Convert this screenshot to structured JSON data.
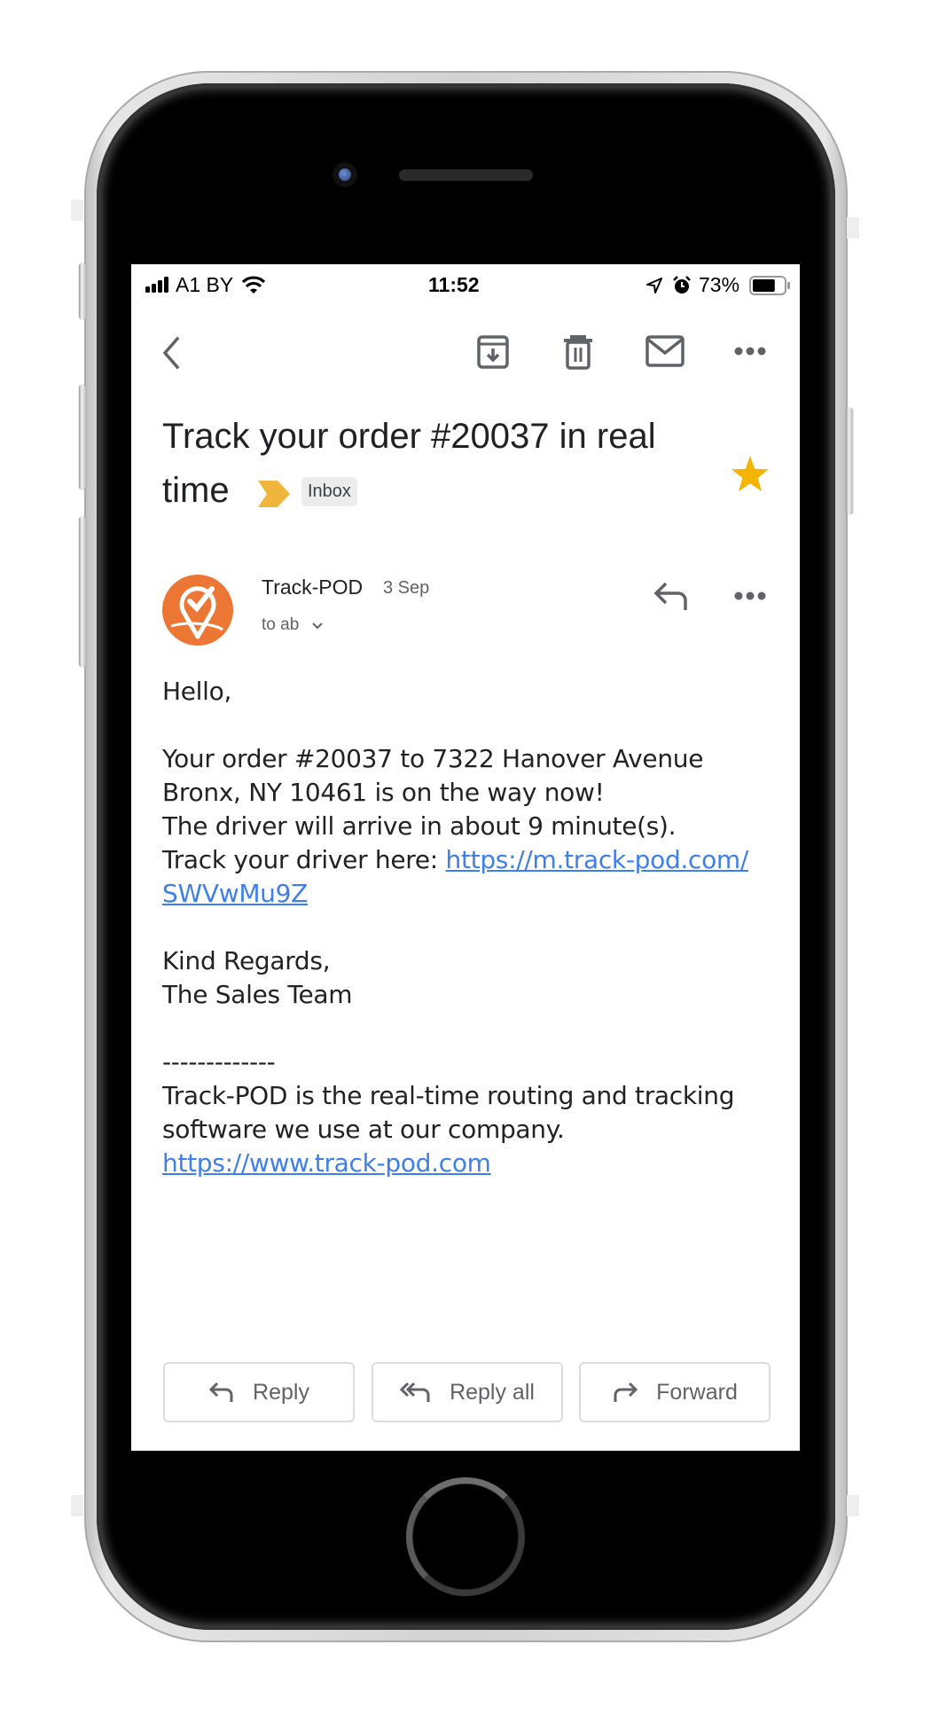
{
  "status_bar": {
    "carrier": "A1 BY",
    "time": "11:52",
    "battery_percent": "73%",
    "battery_level": 0.73
  },
  "toolbar": {
    "icons": [
      "back-icon",
      "archive-icon",
      "trash-icon",
      "mark-unread-icon",
      "more-icon"
    ]
  },
  "email": {
    "subject": "Track your order #20037 in real time",
    "subject_line1": "Track your order #20037 in real",
    "subject_line2": "time",
    "label": "Inbox",
    "starred": true,
    "sender": "Track-POD",
    "date": "3 Sep",
    "recipient": "to ab",
    "body": {
      "greeting": "Hello,",
      "line1": "Your order #20037 to 7322 Hanover Avenue",
      "line2": "Bronx, NY 10461 is on the way now!",
      "line3": "The driver will arrive in about 9 minute(s).",
      "line4_prefix": "Track your driver here: ",
      "tracking_link_part1": "https://m.track-pod.com/",
      "tracking_link_part2": "SWVwMu9Z",
      "closing1": "Kind Regards,",
      "closing2": "The Sales Team",
      "separator": "-------------",
      "footer1": "Track-POD is the real-time routing and tracking",
      "footer2": "software we use at our company.",
      "footer_link": "https://www.track-pod.com"
    }
  },
  "actions": {
    "reply": "Reply",
    "reply_all": "Reply all",
    "forward": "Forward"
  },
  "colors": {
    "accent_link": "#3f7fe8",
    "star": "#f4b400",
    "important": "#f0b53c",
    "avatar": "#ec7633"
  }
}
